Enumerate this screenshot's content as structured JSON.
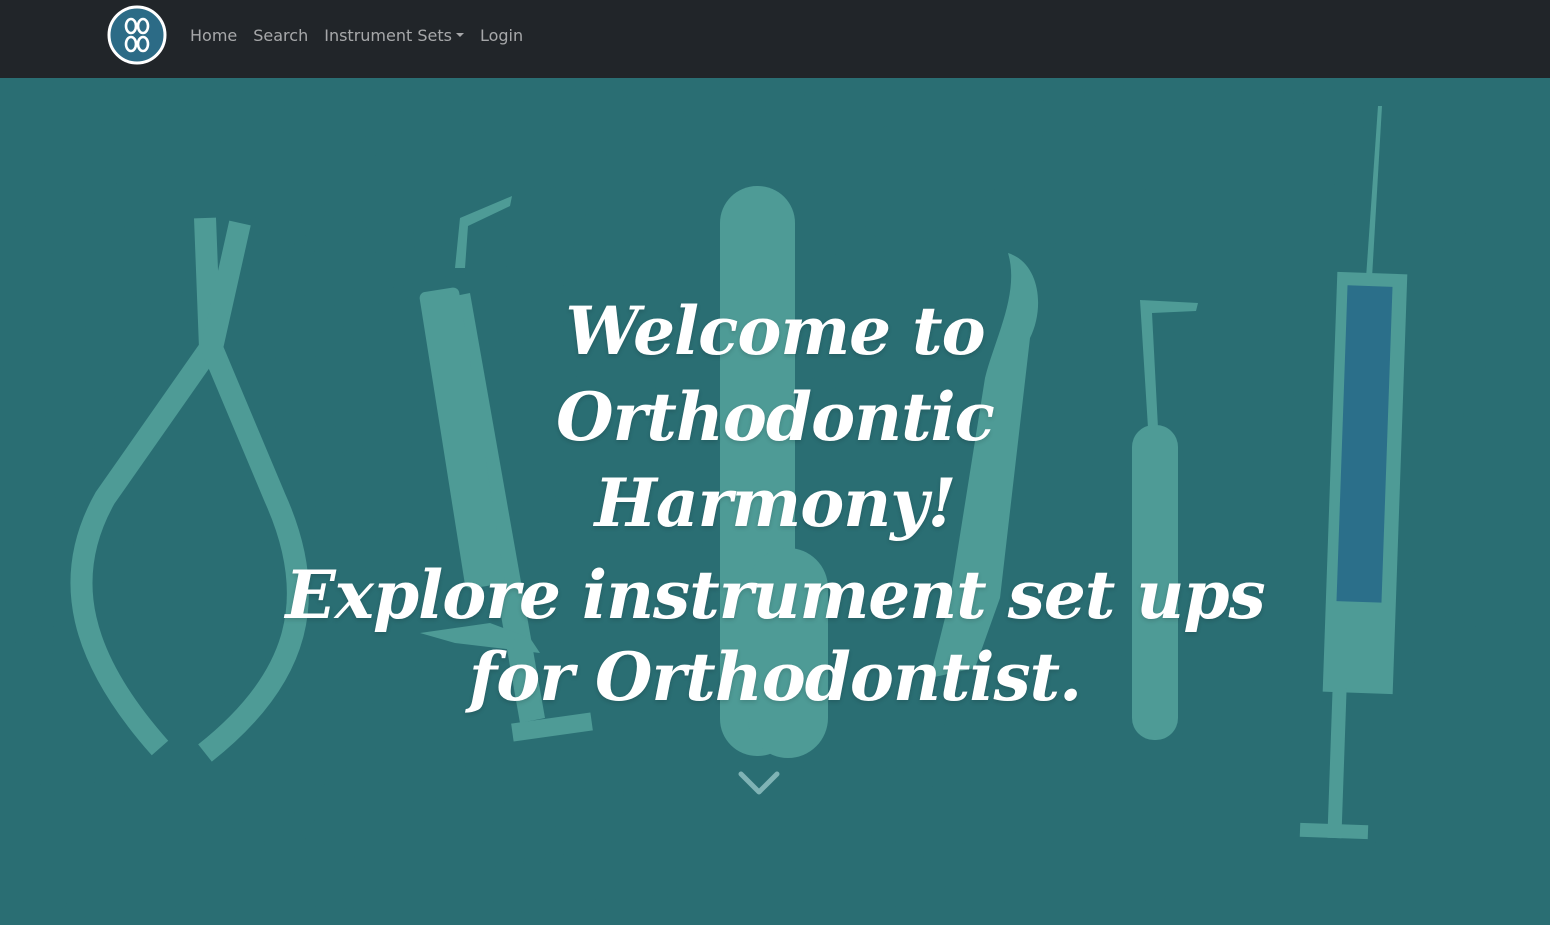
{
  "nav": {
    "logo_icon": "infinity-knot-logo",
    "items": [
      {
        "label": "Home"
      },
      {
        "label": "Search"
      },
      {
        "label": "Instrument Sets"
      },
      {
        "label": "Login"
      }
    ]
  },
  "hero": {
    "title": "Welcome to Orthodontic Harmony!",
    "subtitle": "Explore instrument set ups for Orthodontist.",
    "scroll_icon": "chevron-down-icon",
    "background_color": "#2a6f74",
    "instrument_color": "#4e9b96"
  },
  "colors": {
    "navbar": "#212529",
    "nav_text": "#a6a8aa",
    "hero_text": "#ffffff"
  }
}
